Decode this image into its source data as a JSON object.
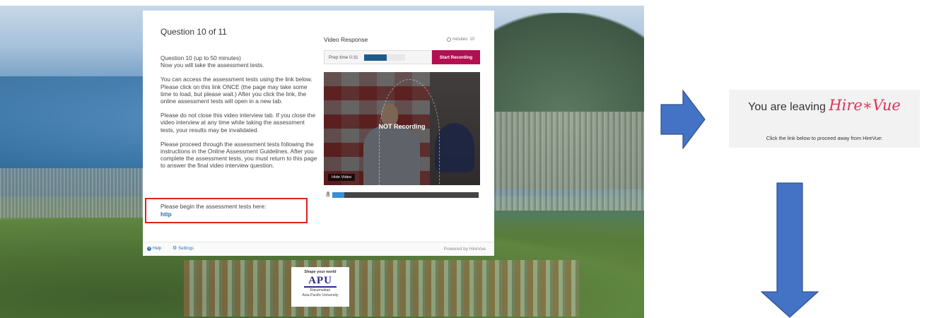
{
  "question": {
    "title": "Question 10 of 11",
    "lead": [
      "Question 10 (up to 50 minutes)",
      "Now you will take the assessment tests."
    ],
    "paragraphs": [
      "You can access the assessment tests using the link below. Please click on this link ONCE (the page may take some time to load, but please wait.) After you click the link, the online assessment tests will open in a new tab.",
      "Please do not close this video interview tab. If you close the video interview at any time while taking the assessment tests, your results may be invalidated.",
      "Please proceed through the assessment tests following the instructions in the Online Assessment Guidelines. After you complete the assessment tests, you must return to this page to answer the final video interview question."
    ],
    "begin_text": "Please begin the assessment tests here:",
    "begin_link": "http"
  },
  "video_response": {
    "title": "Video Response",
    "timer_label": "minutes: 10",
    "prep_label": "Prep time  0:31",
    "prep_progress_pct": 55,
    "start_recording_label": "Start Recording",
    "status_overlay": "NOT Recording",
    "hide_video_label": "Hide Video",
    "mic_level_pct": 8
  },
  "footer": {
    "help_label": "Help",
    "settings_label": "Settings",
    "powered_by": "Powered by HireVue"
  },
  "apu_sign": {
    "tagline": "Shape your world",
    "logo": "APU",
    "name_line1": "Ritsumeikan",
    "name_line2": "Asia Pacific University"
  },
  "leaving_panel": {
    "prefix": "You are leaving",
    "logo": "Hire∗Vue",
    "subtext": "Click the link below to proceed away from HireVue:"
  },
  "colors": {
    "arrow_fill": "#4472c4",
    "arrow_stroke": "#2f528f",
    "record_button": "#b30e52",
    "highlight_box": "#e0201c",
    "hirevue_logo": "#e0305b"
  },
  "icons": [
    "clock-icon",
    "microphone-icon",
    "help-icon",
    "gear-icon",
    "arrow-right",
    "arrow-down"
  ]
}
